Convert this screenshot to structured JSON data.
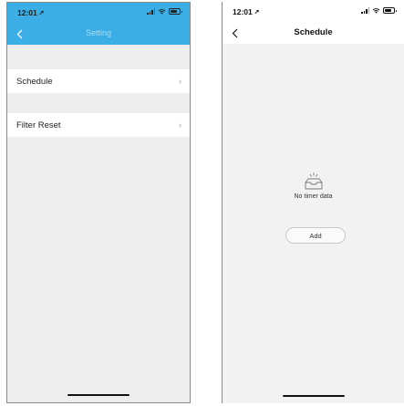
{
  "left_screen": {
    "status": {
      "time": "12:01"
    },
    "nav": {
      "title": "Setting"
    },
    "menu": [
      {
        "label": "Schedule"
      },
      {
        "label": "Filter Reset"
      }
    ],
    "chevron": "›"
  },
  "right_screen": {
    "status": {
      "time": "12:01"
    },
    "nav": {
      "title": "Schedule"
    },
    "empty": {
      "text": "No timer data"
    },
    "add_label": "Add"
  },
  "icons": [
    "location-arrow-icon",
    "signal-icon",
    "wifi-icon",
    "battery-icon",
    "back-chevron-icon",
    "chevron-right-icon",
    "empty-inbox-icon"
  ],
  "colors": {
    "header": "#3aaee5",
    "title_on_header": "#a9dcf5",
    "background_left": "#eeeeee",
    "background_right": "#f2f2f2"
  }
}
